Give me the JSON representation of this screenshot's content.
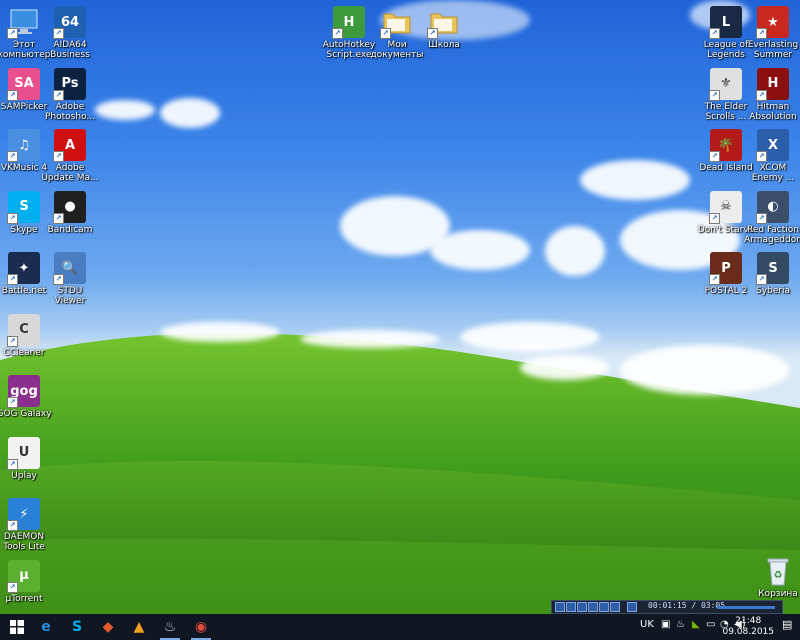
{
  "desktop": {
    "left_column": [
      {
        "label": "Этот компьютер",
        "icon": "computer-icon",
        "color": "#5aa6e8",
        "glyph": ""
      },
      {
        "label": "SAMPicker",
        "icon": "sampicker-icon",
        "color": "#e94f8c",
        "glyph": "SA"
      },
      {
        "label": "VKMusic 4",
        "icon": "vkmusic-icon",
        "color": "#4a90e2",
        "glyph": "♫"
      },
      {
        "label": "Skype",
        "icon": "skype-icon",
        "color": "#00aff0",
        "glyph": "S"
      },
      {
        "label": "Battle.net",
        "icon": "battlenet-icon",
        "color": "#1b2d4f",
        "glyph": "✦"
      },
      {
        "label": "CCleaner",
        "icon": "ccleaner-icon",
        "color": "#d8d8d8",
        "glyph": "C"
      },
      {
        "label": "GOG Galaxy",
        "icon": "gog-icon",
        "color": "#8b2f8e",
        "glyph": "gog"
      },
      {
        "label": "Uplay",
        "icon": "uplay-icon",
        "color": "#f2f2f2",
        "glyph": "U"
      },
      {
        "label": "DAEMON Tools Lite",
        "icon": "daemon-tools-icon",
        "color": "#2a7fd6",
        "glyph": "⚡"
      },
      {
        "label": "µTorrent",
        "icon": "utorrent-icon",
        "color": "#5bb030",
        "glyph": "µ"
      }
    ],
    "second_column": [
      {
        "label": "AIDA64 Business",
        "icon": "aida64-icon",
        "color": "#2060b0",
        "glyph": "64"
      },
      {
        "label": "Adobe Photosho...",
        "icon": "photoshop-icon",
        "color": "#0b2340",
        "glyph": "Ps"
      },
      {
        "label": "Adobe Update Ma...",
        "icon": "adobe-update-icon",
        "color": "#d01010",
        "glyph": "A"
      },
      {
        "label": "Bandicam",
        "icon": "bandicam-icon",
        "color": "#202020",
        "glyph": "●"
      },
      {
        "label": "STDU Viewer",
        "icon": "stdu-viewer-icon",
        "color": "#4a7cc2",
        "glyph": "🔍"
      }
    ],
    "top_center": [
      {
        "label": "AutoHotkey Script.exe",
        "icon": "autohotkey-icon",
        "color": "#3d9a3d",
        "glyph": "H"
      },
      {
        "label": "Мои документы",
        "icon": "folder-icon",
        "color": "#e8c45a",
        "glyph": ""
      },
      {
        "label": "Школа",
        "icon": "school-folder-icon",
        "color": "#e8c45a",
        "glyph": ""
      }
    ],
    "right_column_a": [
      {
        "label": "League of Legends",
        "icon": "league-of-legends-icon",
        "color": "#1a2a44",
        "glyph": "L"
      },
      {
        "label": "The Elder Scrolls ...",
        "icon": "elder-scrolls-icon",
        "color": "#e0e0e0",
        "glyph": "⚜"
      },
      {
        "label": "Dead Island",
        "icon": "dead-island-icon",
        "color": "#b31b1b",
        "glyph": "🌴"
      },
      {
        "label": "Don't Starve",
        "icon": "dont-starve-icon",
        "color": "#ececec",
        "glyph": "☠"
      },
      {
        "label": "POSTAL 2",
        "icon": "postal2-icon",
        "color": "#6a2b1a",
        "glyph": "P"
      }
    ],
    "right_column_b": [
      {
        "label": "Everlasting Summer",
        "icon": "everlasting-summer-icon",
        "color": "#c9281f",
        "glyph": "★"
      },
      {
        "label": "Hitman Absolution",
        "icon": "hitman-icon",
        "color": "#8a0f0f",
        "glyph": "H"
      },
      {
        "label": "XCOM Enemy ...",
        "icon": "xcom-icon",
        "color": "#2b5da8",
        "glyph": "X"
      },
      {
        "label": "Red Faction Armageddon",
        "icon": "red-faction-icon",
        "color": "#3b4f6b",
        "glyph": "◐"
      },
      {
        "label": "Syberia",
        "icon": "syberia-icon",
        "color": "#324a62",
        "glyph": "S"
      }
    ],
    "recycle_bin": {
      "label": "Корзина",
      "icon": "recycle-bin-icon"
    }
  },
  "media_player": {
    "time": "00:01:15 / 03:05"
  },
  "taskbar": {
    "pinned": [
      {
        "name": "edge-icon",
        "glyph": "e",
        "color": "#2a8fe0"
      },
      {
        "name": "skype-taskbar-icon",
        "glyph": "S",
        "color": "#00aff0"
      },
      {
        "name": "paint-icon",
        "glyph": "◆",
        "color": "#e05a2a"
      },
      {
        "name": "aimp-icon",
        "glyph": "▲",
        "color": "#f0a020"
      },
      {
        "name": "steam-icon",
        "glyph": "♨",
        "color": "#c7d5e0"
      },
      {
        "name": "chrome-icon",
        "glyph": "◉",
        "color": "#e24a3c"
      }
    ],
    "language": "UK",
    "time": "21:48",
    "date": "09.08.2015"
  }
}
